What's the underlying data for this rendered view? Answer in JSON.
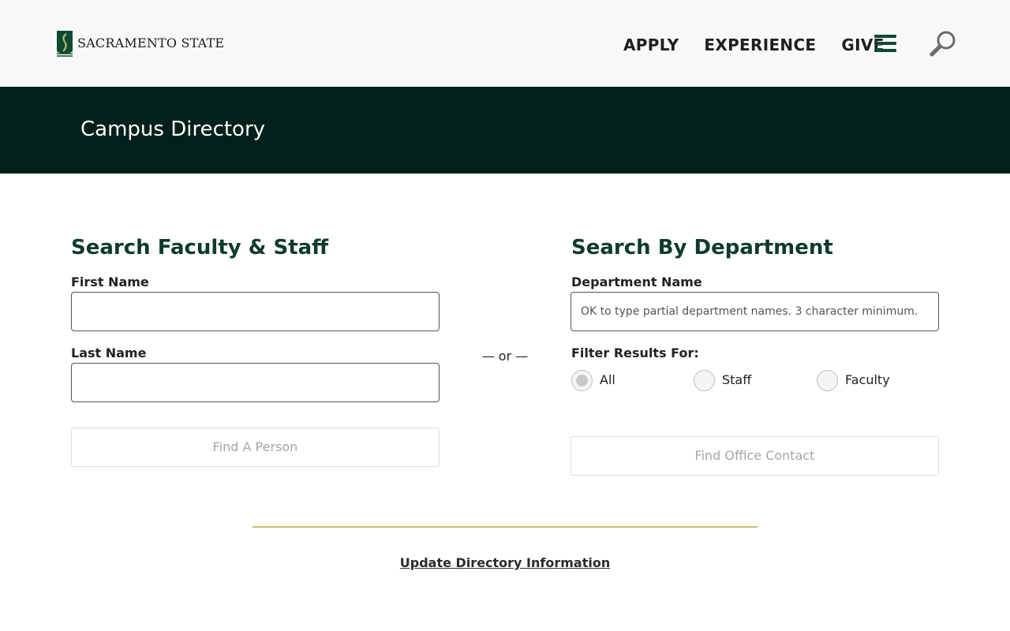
{
  "header": {
    "logo_text": "SACRAMENTO STATE",
    "nav": [
      "APPLY",
      "EXPERIENCE",
      "GIVE"
    ],
    "menu_icon": "hamburger-menu-icon",
    "search_icon": "magnifier-search-icon"
  },
  "banner": {
    "title": "Campus Directory"
  },
  "person_search": {
    "title": "Search Faculty & Staff",
    "first_name_label": "First Name",
    "first_name_value": "",
    "last_name_label": "Last Name",
    "last_name_value": "",
    "button_label": "Find A Person"
  },
  "separator": "— or —",
  "department_search": {
    "title": "Search By Department",
    "department_label": "Department Name",
    "department_placeholder": "OK to type partial department names. 3 character minimum.",
    "filter_label": "Filter Results For:",
    "filter_options": [
      "All",
      "Staff",
      "Faculty"
    ],
    "filter_selected": "All",
    "button_label": "Find Office Contact"
  },
  "footer": {
    "link": "Update Directory Information"
  },
  "colors": {
    "banner_bg": "#03211a",
    "heading_green": "#0e3b2b",
    "divider_gold": "#c4bf6c",
    "header_bg": "#f8f8f8"
  }
}
